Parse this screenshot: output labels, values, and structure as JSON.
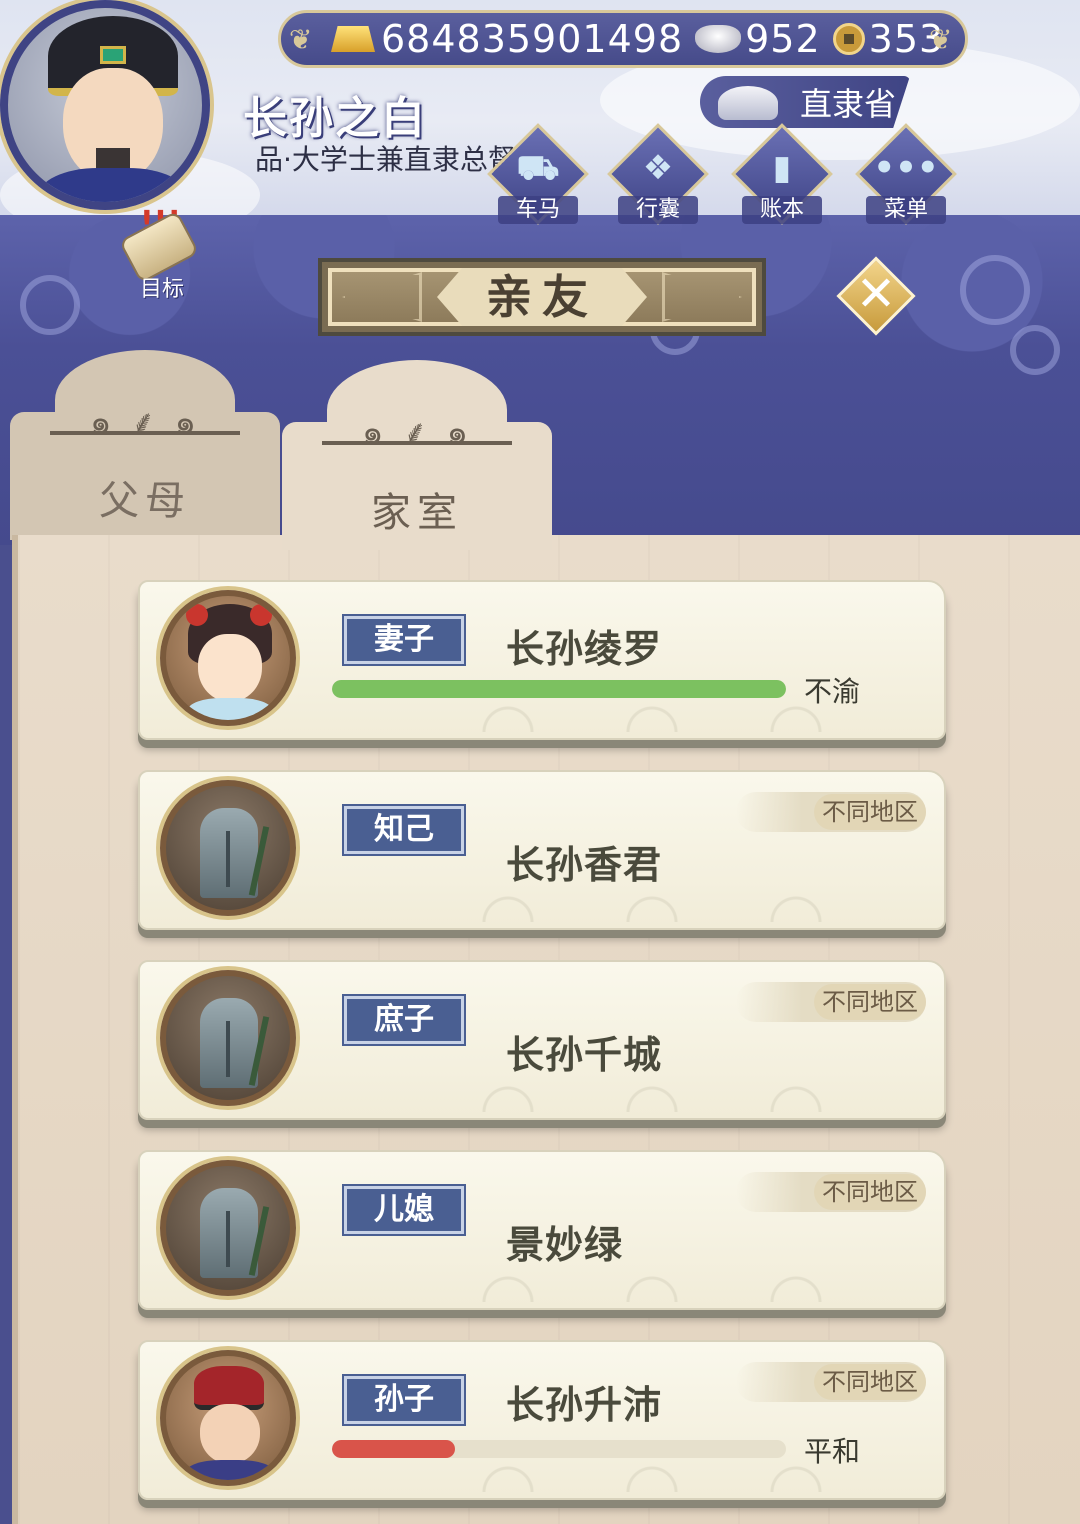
{
  "resources": {
    "gold": "684835901498",
    "silver": "952",
    "coins": "353"
  },
  "player": {
    "name": "长孙之白",
    "title": "品·大学士兼直隶总督"
  },
  "province": "直隶省",
  "menu": [
    {
      "label": "车马",
      "icon": "carriage-icon"
    },
    {
      "label": "行囊",
      "icon": "bundle-icon"
    },
    {
      "label": "账本",
      "icon": "ledger-icon"
    },
    {
      "label": "菜单",
      "icon": "menu-dots-icon"
    }
  ],
  "goal_label": "目标",
  "page_title": "亲友",
  "tabs": [
    {
      "label": "父母",
      "active": false
    },
    {
      "label": "家室",
      "active": true
    }
  ],
  "relatives": [
    {
      "relation": "妻子",
      "name": "长孙绫罗",
      "mood": "不渝",
      "mood_level": 1.0,
      "mood_color": "#7cc160",
      "portrait": "wife",
      "region": ""
    },
    {
      "relation": "知己",
      "name": "长孙香君",
      "mood": "",
      "portrait": "tomb",
      "region": "不同地区"
    },
    {
      "relation": "庶子",
      "name": "长孙千城",
      "mood": "",
      "portrait": "tomb",
      "region": "不同地区"
    },
    {
      "relation": "儿媳",
      "name": "景妙绿",
      "mood": "",
      "portrait": "tomb",
      "region": "不同地区"
    },
    {
      "relation": "孙子",
      "name": "长孙升沛",
      "mood": "平和",
      "mood_level": 0.27,
      "mood_color": "#d9544a",
      "portrait": "grandson",
      "region": "不同地区"
    }
  ]
}
